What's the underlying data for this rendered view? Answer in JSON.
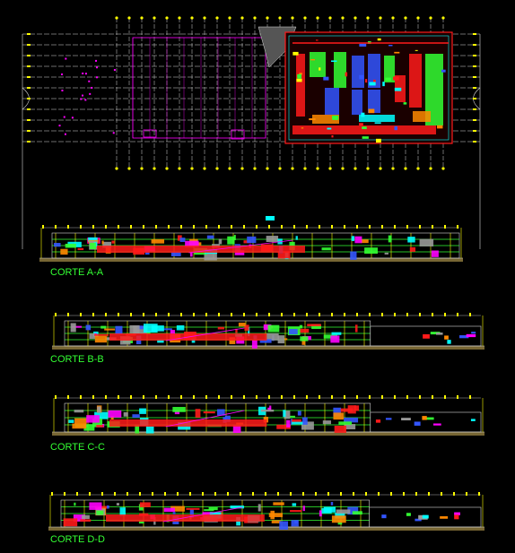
{
  "drawing": {
    "background": "#000000",
    "colors": {
      "grid_white": "#d8d8d8",
      "grid_yellow": "#ffff00",
      "magenta": "#ff00ff",
      "red": "#ff1a1a",
      "green": "#33ff33",
      "cyan": "#00ffff",
      "blue": "#3355ff",
      "orange": "#ff8800",
      "gray": "#999999",
      "label_green": "#33ff33"
    }
  },
  "sections": [
    {
      "label": "CORTE A-A"
    },
    {
      "label": "CORTE B-B"
    },
    {
      "label": "CORTE C-C"
    },
    {
      "label": "CORTE D-D"
    }
  ]
}
